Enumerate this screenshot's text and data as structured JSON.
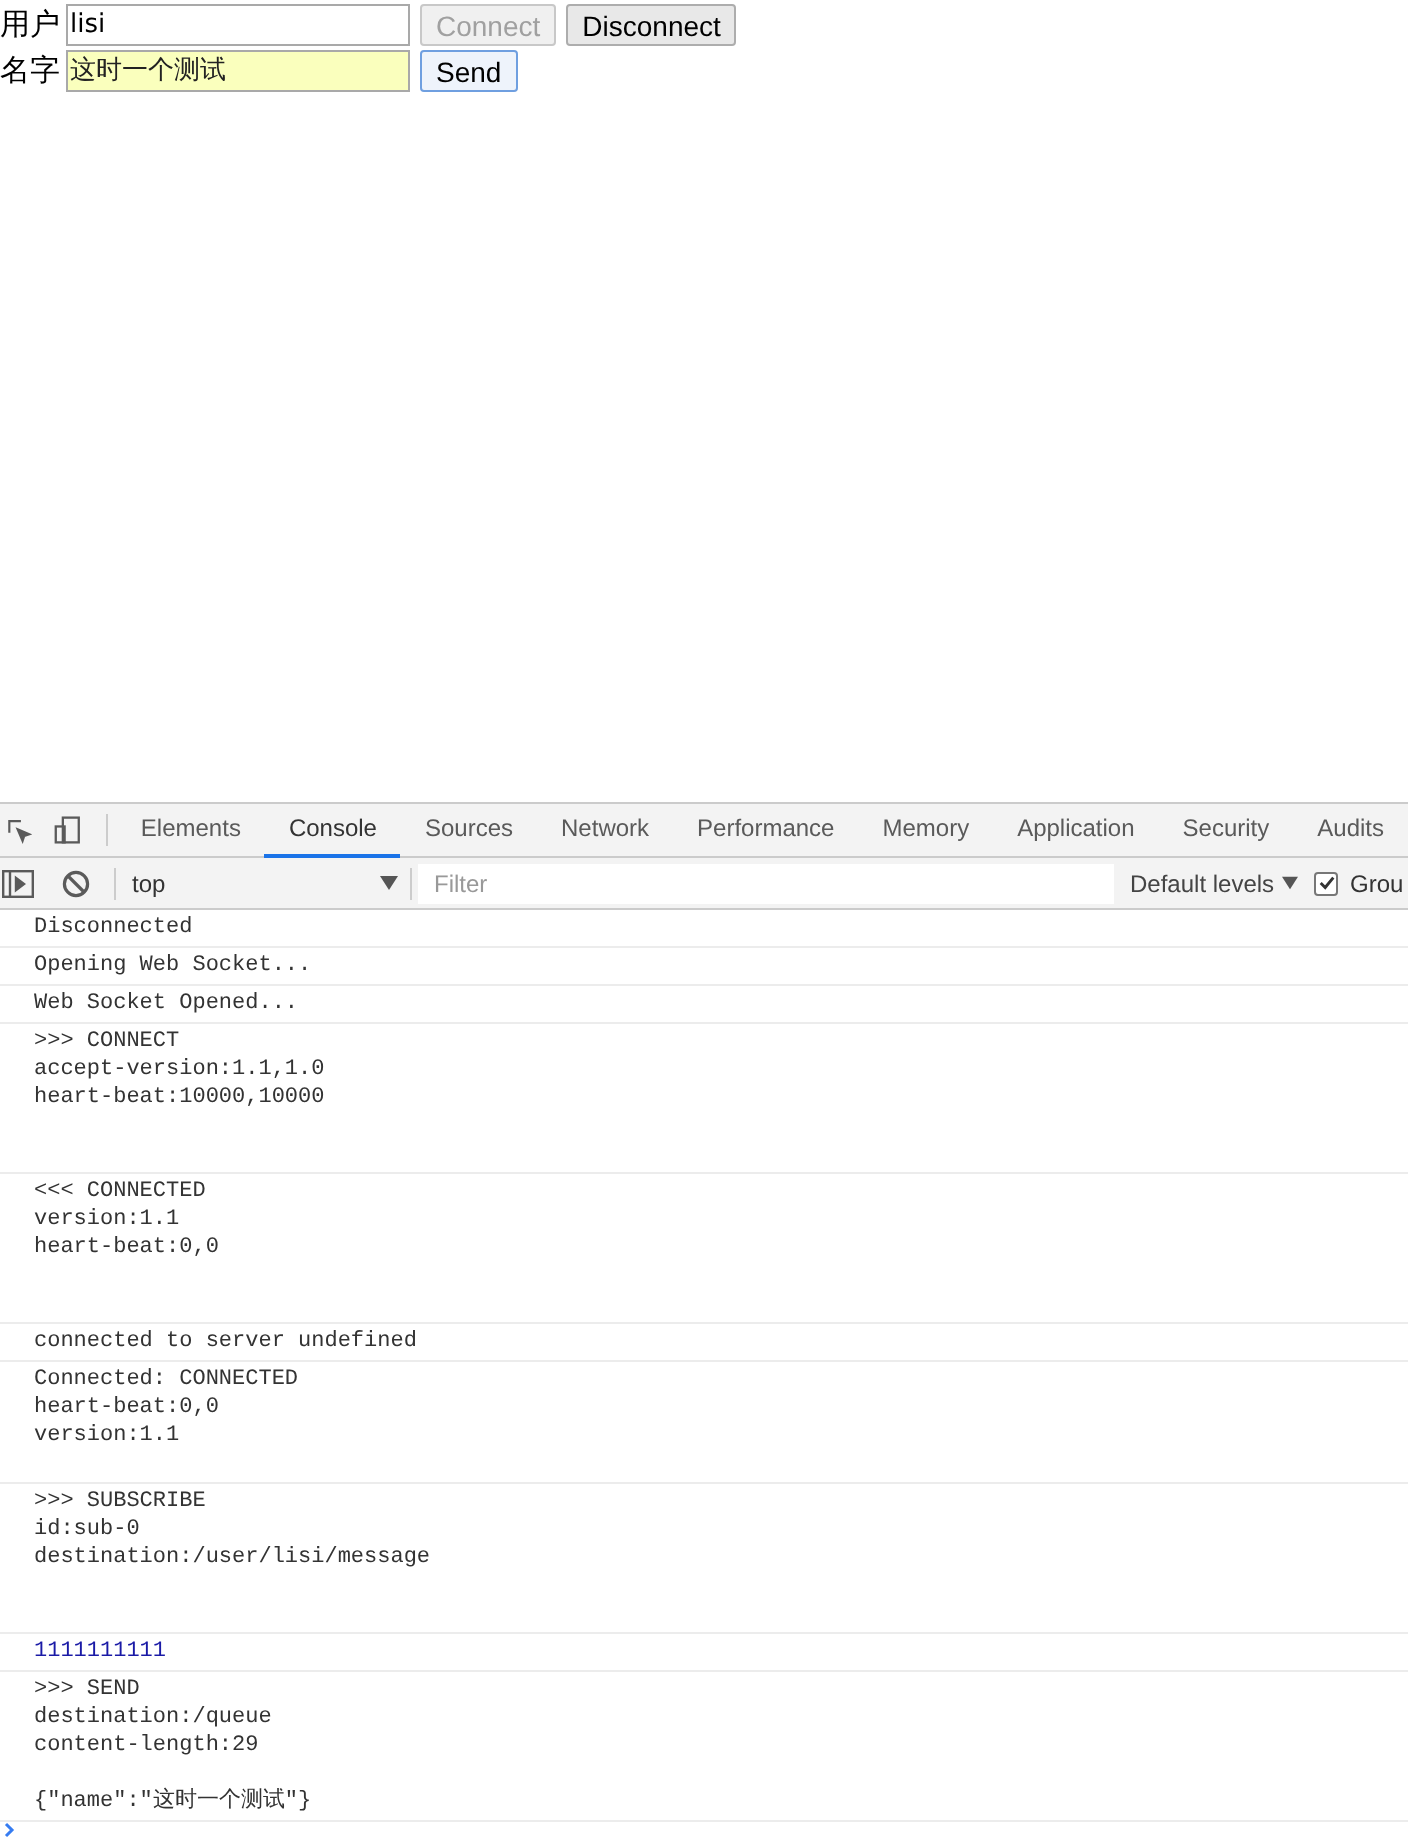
{
  "form": {
    "rows": [
      {
        "label": "用户",
        "value": "lisi",
        "autofilled": false,
        "buttons": [
          {
            "label": "Connect",
            "disabled": true,
            "focused": false
          },
          {
            "label": "Disconnect",
            "disabled": false,
            "focused": false
          }
        ]
      },
      {
        "label": "名字",
        "value": "这时一个测试",
        "autofilled": true,
        "buttons": [
          {
            "label": "Send",
            "disabled": false,
            "focused": true
          }
        ]
      }
    ]
  },
  "devtools": {
    "tabs": [
      {
        "label": "Elements",
        "selected": false
      },
      {
        "label": "Console",
        "selected": true
      },
      {
        "label": "Sources",
        "selected": false
      },
      {
        "label": "Network",
        "selected": false
      },
      {
        "label": "Performance",
        "selected": false
      },
      {
        "label": "Memory",
        "selected": false
      },
      {
        "label": "Application",
        "selected": false
      },
      {
        "label": "Security",
        "selected": false
      },
      {
        "label": "Audits",
        "selected": false
      }
    ],
    "toolbar": {
      "context": "top",
      "filter_placeholder": "Filter",
      "levels": "Default levels",
      "group_checked": true,
      "group_label": "Grou"
    },
    "messages": [
      {
        "kind": "text",
        "text": "Disconnected"
      },
      {
        "kind": "text",
        "text": "Opening Web Socket..."
      },
      {
        "kind": "text",
        "text": "Web Socket Opened..."
      },
      {
        "kind": "text",
        "text": ">>> CONNECT\naccept-version:1.1,1.0\nheart-beat:10000,10000\n\n"
      },
      {
        "kind": "text",
        "text": "<<< CONNECTED\nversion:1.1\nheart-beat:0,0\n\n"
      },
      {
        "kind": "text",
        "text": "connected to server undefined"
      },
      {
        "kind": "text",
        "text": "Connected: CONNECTED\nheart-beat:0,0\nversion:1.1\n"
      },
      {
        "kind": "text",
        "text": ">>> SUBSCRIBE\nid:sub-0\ndestination:/user/lisi/message\n\n"
      },
      {
        "kind": "number",
        "text": "1111111111"
      },
      {
        "kind": "text",
        "text": ">>> SEND\ndestination:/queue\ncontent-length:29\n\n{\"name\":\"这时一个测试\"}"
      }
    ]
  }
}
